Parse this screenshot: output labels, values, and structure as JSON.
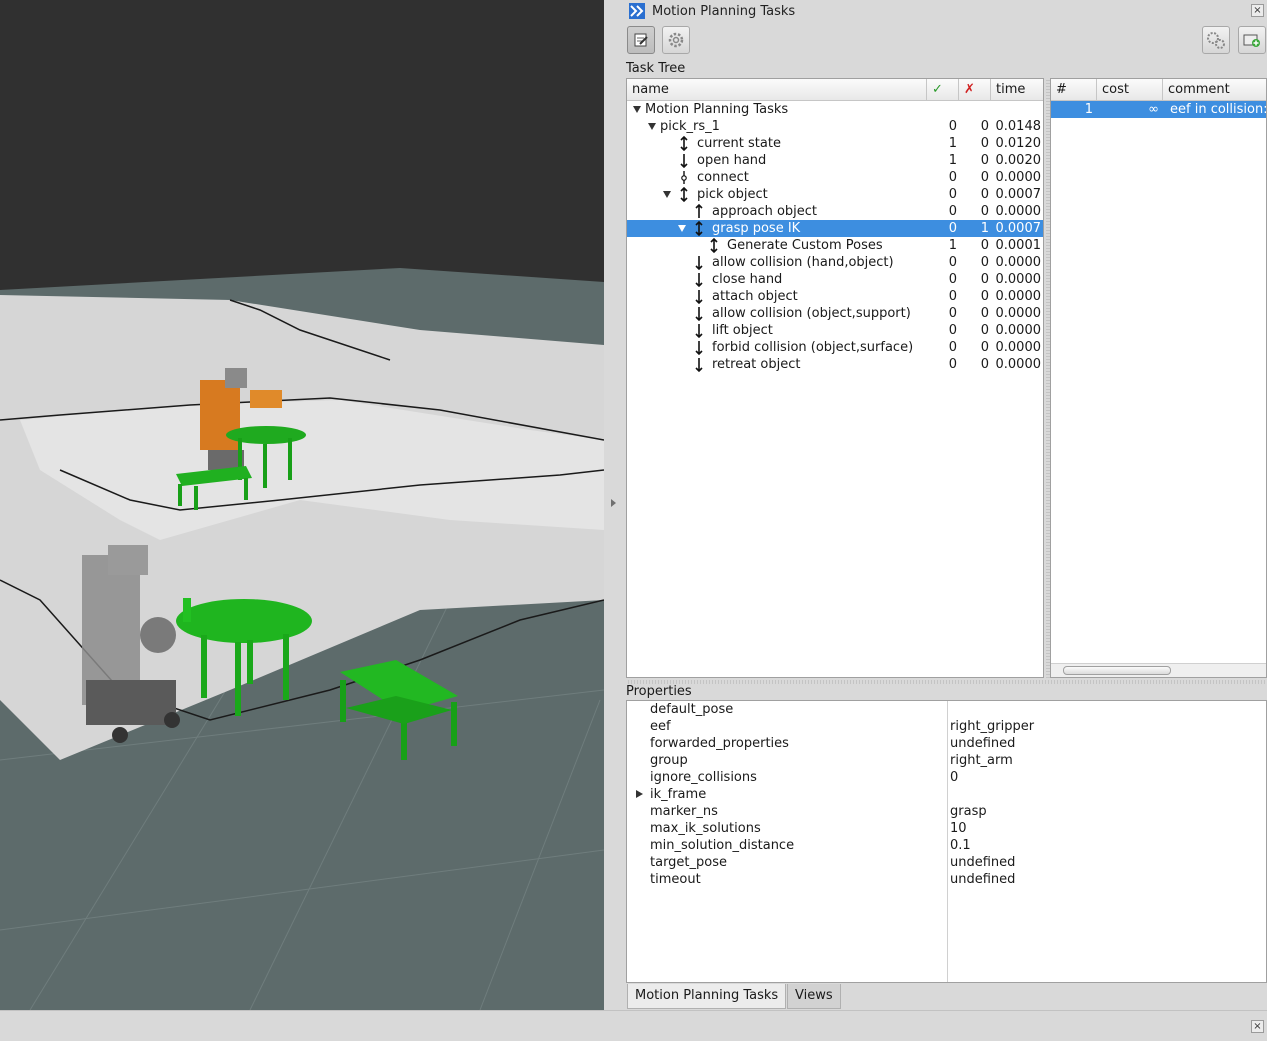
{
  "window": {
    "title": "Motion Planning Tasks"
  },
  "toolbar": {
    "left_icons": [
      "edit-icon",
      "settings-gear-icon"
    ],
    "right_icons": [
      "gears-icon",
      "add-panel-icon"
    ]
  },
  "task_tree": {
    "label": "Task Tree",
    "columns": {
      "name": "name",
      "ok": "✓",
      "fail": "✗",
      "time": "time"
    },
    "rows": [
      {
        "name": "Motion Planning Tasks",
        "ok": "",
        "fail": "",
        "time": ""
      },
      {
        "name": "pick_rs_1",
        "ok": "0",
        "fail": "0",
        "time": "0.0148"
      },
      {
        "name": "current state",
        "ok": "1",
        "fail": "0",
        "time": "0.0120",
        "icon": "updown-arrow-icon"
      },
      {
        "name": "open hand",
        "ok": "1",
        "fail": "0",
        "time": "0.0020",
        "icon": "down-arrow-icon"
      },
      {
        "name": "connect",
        "ok": "0",
        "fail": "0",
        "time": "0.0000",
        "icon": "connect-icon"
      },
      {
        "name": "pick object",
        "ok": "0",
        "fail": "0",
        "time": "0.0007",
        "icon": "updown-arrow-icon"
      },
      {
        "name": "approach object",
        "ok": "0",
        "fail": "0",
        "time": "0.0000",
        "icon": "up-arrow-icon"
      },
      {
        "name": "grasp pose IK",
        "ok": "0",
        "fail": "1",
        "time": "0.0007",
        "icon": "updown-arrow-icon"
      },
      {
        "name": "Generate Custom Poses",
        "ok": "1",
        "fail": "0",
        "time": "0.0001",
        "icon": "updown-arrow-icon"
      },
      {
        "name": "allow collision (hand,object)",
        "ok": "0",
        "fail": "0",
        "time": "0.0000",
        "icon": "down-arrow-icon"
      },
      {
        "name": "close hand",
        "ok": "0",
        "fail": "0",
        "time": "0.0000",
        "icon": "down-arrow-icon"
      },
      {
        "name": "attach object",
        "ok": "0",
        "fail": "0",
        "time": "0.0000",
        "icon": "down-arrow-icon"
      },
      {
        "name": "allow collision (object,support)",
        "ok": "0",
        "fail": "0",
        "time": "0.0000",
        "icon": "down-arrow-icon"
      },
      {
        "name": "lift object",
        "ok": "0",
        "fail": "0",
        "time": "0.0000",
        "icon": "down-arrow-icon"
      },
      {
        "name": "forbid collision (object,surface)",
        "ok": "0",
        "fail": "0",
        "time": "0.0000",
        "icon": "down-arrow-icon"
      },
      {
        "name": "retreat object",
        "ok": "0",
        "fail": "0",
        "time": "0.0000",
        "icon": "down-arrow-icon"
      }
    ],
    "selected_row": "grasp pose IK"
  },
  "solutions": {
    "columns": {
      "index": "#",
      "cost": "cost",
      "comment": "comment"
    },
    "rows": [
      {
        "index": "1",
        "cost": "∞",
        "comment": "eef in collision:"
      }
    ]
  },
  "properties": {
    "label": "Properties",
    "rows": [
      {
        "key": "default_pose",
        "value": ""
      },
      {
        "key": "eef",
        "value": "right_gripper"
      },
      {
        "key": "forwarded_properties",
        "value": "undefined"
      },
      {
        "key": "group",
        "value": "right_arm"
      },
      {
        "key": "ignore_collisions",
        "value": "0"
      },
      {
        "key": "ik_frame",
        "value": ""
      },
      {
        "key": "marker_ns",
        "value": "grasp"
      },
      {
        "key": "max_ik_solutions",
        "value": "10"
      },
      {
        "key": "min_solution_distance",
        "value": "0.1"
      },
      {
        "key": "target_pose",
        "value": "undefined"
      },
      {
        "key": "timeout",
        "value": "undefined"
      }
    ]
  },
  "tabs": [
    {
      "label": "Motion Planning Tasks",
      "active": true
    },
    {
      "label": "Views",
      "active": false
    }
  ],
  "colors": {
    "selection": "#3d8ee0",
    "ok_check": "#2a9a2a",
    "fail_cross": "#d02020",
    "ground": "#5b6b6b",
    "table_green": "#1fb51f",
    "robot_orange": "#e07a1a"
  }
}
